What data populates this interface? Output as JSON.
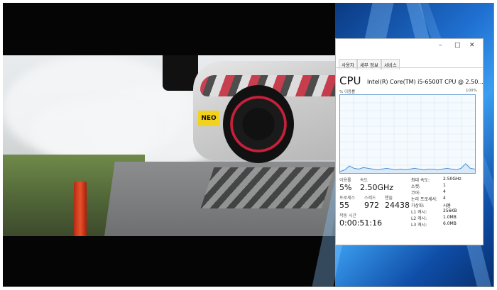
{
  "video": {
    "sticker": "NEO"
  },
  "task_manager": {
    "window_controls": {
      "minimize": "–",
      "maximize": "□",
      "close": "✕"
    },
    "tabs": [
      "사용자",
      "세부 정보",
      "서비스"
    ],
    "title": "CPU",
    "model": "Intel(R) Core(TM) i5-6500T CPU @ 2.50...",
    "util_label": "% 이용률",
    "util_max": "100%",
    "utilization_label": "이용률",
    "utilization_value": "5%",
    "speed_label": "속도",
    "speed_value": "2.50GHz",
    "processes_label": "프로세스",
    "processes_value": "55",
    "threads_label": "스레드",
    "threads_value": "972",
    "handles_label": "핸들",
    "handles_value": "24438",
    "uptime_label": "작동 시간",
    "uptime_value": "0:00:51:16",
    "specs": [
      {
        "label": "최대 속도:",
        "value": "2.50GHz"
      },
      {
        "label": "소켓:",
        "value": "1"
      },
      {
        "label": "코어:",
        "value": "4"
      },
      {
        "label": "논리 프로세서:",
        "value": "4"
      },
      {
        "label": "가상화:",
        "value": "사용"
      },
      {
        "label": "L1 캐시:",
        "value": "256KB"
      },
      {
        "label": "L2 캐시:",
        "value": "1.0MB"
      },
      {
        "label": "L3 캐시:",
        "value": "6.0MB"
      }
    ],
    "graph_points": [
      2,
      4,
      9,
      6,
      5,
      7,
      6,
      5,
      4,
      5,
      6,
      5,
      4,
      5,
      4,
      5,
      6,
      5,
      4,
      5,
      5,
      4,
      5,
      6,
      5,
      4,
      6,
      12,
      6,
      5
    ],
    "graph_color": "#4b8fd1"
  }
}
